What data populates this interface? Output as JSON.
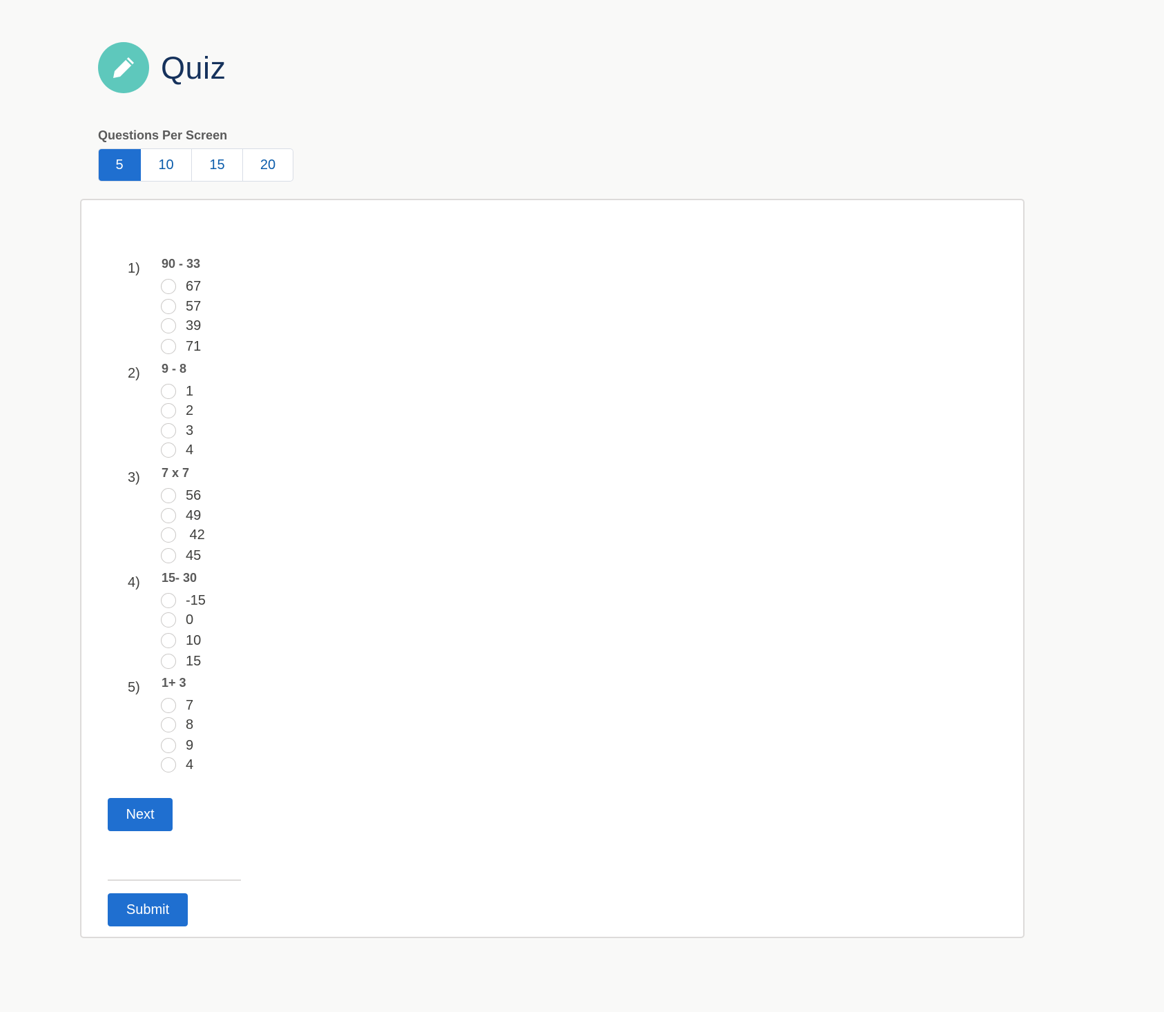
{
  "header": {
    "title": "Quiz",
    "icon": "pencil-icon",
    "icon_color": "#5ec8bc"
  },
  "questions_per_screen": {
    "label": "Questions Per Screen",
    "options": [
      "5",
      "10",
      "15",
      "20"
    ],
    "selected": "5"
  },
  "questions": [
    {
      "number": "1)",
      "text": "90 - 33",
      "options": [
        "67",
        "57",
        "39",
        "71"
      ]
    },
    {
      "number": "2)",
      "text": "9 - 8",
      "options": [
        "1",
        "2",
        "3",
        "4"
      ]
    },
    {
      "number": "3)",
      "text": "7 x 7",
      "options": [
        "56",
        "49",
        " 42",
        "45"
      ]
    },
    {
      "number": "4)",
      "text": "15- 30",
      "options": [
        "-15",
        "0",
        "10",
        "15"
      ]
    },
    {
      "number": "5)",
      "text": "1+ 3",
      "options": [
        "7",
        "8",
        "9",
        "4"
      ]
    }
  ],
  "actions": {
    "next_label": "Next",
    "submit_label": "Submit"
  },
  "colors": {
    "accent": "#1f6fd0",
    "title": "#16325c",
    "background": "#f9f9f8"
  }
}
